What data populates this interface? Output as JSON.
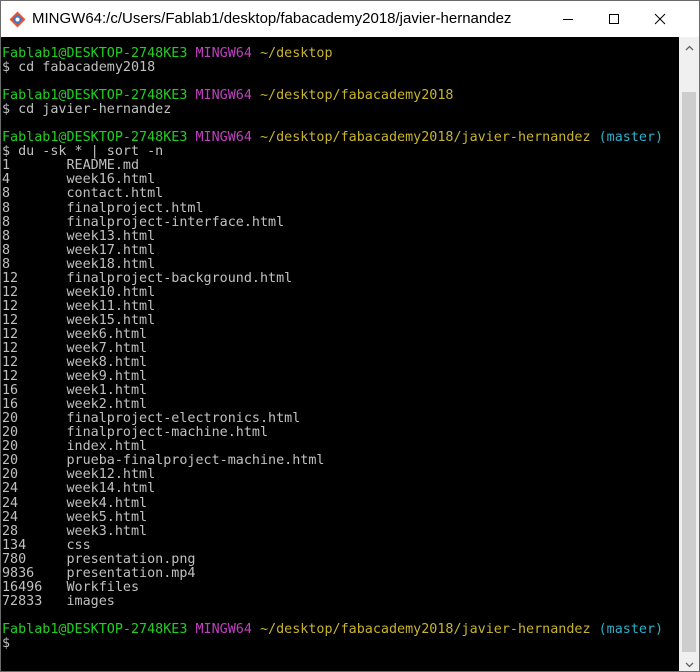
{
  "window": {
    "title": "MINGW64:/c/Users/Fablab1/desktop/fabacademy2018/javier-hernandez",
    "controls": {
      "minimize": "minimize-icon",
      "maximize": "maximize-icon",
      "close": "close-icon"
    }
  },
  "colors": {
    "prompt_user": "#20d020",
    "prompt_system": "#c040c0",
    "prompt_path": "#c8b42a",
    "prompt_branch": "#2ab0c8",
    "output_text": "#c0c0c0",
    "background": "#000000"
  },
  "terminal": {
    "prompts": [
      {
        "user": "Fablab1@DESKTOP-2748KE3",
        "system": "MINGW64",
        "path": "~/desktop",
        "branch": "",
        "command": "$ cd fabacademy2018"
      },
      {
        "user": "Fablab1@DESKTOP-2748KE3",
        "system": "MINGW64",
        "path": "~/desktop/fabacademy2018",
        "branch": "",
        "command": "$ cd javier-hernandez"
      },
      {
        "user": "Fablab1@DESKTOP-2748KE3",
        "system": "MINGW64",
        "path": "~/desktop/fabacademy2018/javier-hernandez",
        "branch": "(master)",
        "command": "$ du -sk * | sort -n"
      },
      {
        "user": "Fablab1@DESKTOP-2748KE3",
        "system": "MINGW64",
        "path": "~/desktop/fabacademy2018/javier-hernandez",
        "branch": "(master)",
        "command": "$"
      }
    ],
    "output": [
      {
        "size": "1",
        "name": "README.md"
      },
      {
        "size": "4",
        "name": "week16.html"
      },
      {
        "size": "8",
        "name": "contact.html"
      },
      {
        "size": "8",
        "name": "finalproject.html"
      },
      {
        "size": "8",
        "name": "finalproject-interface.html"
      },
      {
        "size": "8",
        "name": "week13.html"
      },
      {
        "size": "8",
        "name": "week17.html"
      },
      {
        "size": "8",
        "name": "week18.html"
      },
      {
        "size": "12",
        "name": "finalproject-background.html"
      },
      {
        "size": "12",
        "name": "week10.html"
      },
      {
        "size": "12",
        "name": "week11.html"
      },
      {
        "size": "12",
        "name": "week15.html"
      },
      {
        "size": "12",
        "name": "week6.html"
      },
      {
        "size": "12",
        "name": "week7.html"
      },
      {
        "size": "12",
        "name": "week8.html"
      },
      {
        "size": "12",
        "name": "week9.html"
      },
      {
        "size": "16",
        "name": "week1.html"
      },
      {
        "size": "16",
        "name": "week2.html"
      },
      {
        "size": "20",
        "name": "finalproject-electronics.html"
      },
      {
        "size": "20",
        "name": "finalproject-machine.html"
      },
      {
        "size": "20",
        "name": "index.html"
      },
      {
        "size": "20",
        "name": "prueba-finalproject-machine.html"
      },
      {
        "size": "20",
        "name": "week12.html"
      },
      {
        "size": "24",
        "name": "week14.html"
      },
      {
        "size": "24",
        "name": "week4.html"
      },
      {
        "size": "24",
        "name": "week5.html"
      },
      {
        "size": "28",
        "name": "week3.html"
      },
      {
        "size": "134",
        "name": "css"
      },
      {
        "size": "780",
        "name": "presentation.png"
      },
      {
        "size": "9836",
        "name": "presentation.mp4"
      },
      {
        "size": "16496",
        "name": "Workfiles"
      },
      {
        "size": "72833",
        "name": "images"
      }
    ]
  }
}
